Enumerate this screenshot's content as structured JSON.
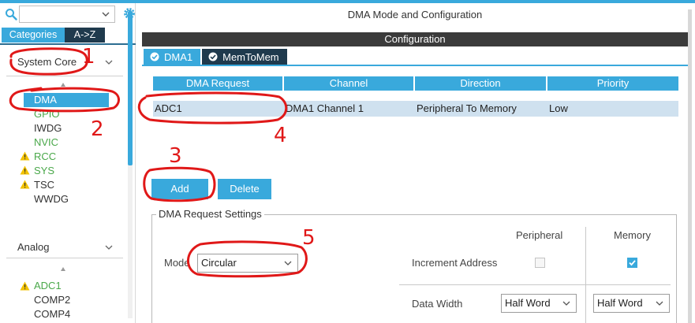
{
  "left": {
    "search": {
      "value": "",
      "placeholder": ""
    },
    "tabs": {
      "categories": "Categories",
      "az": "A->Z"
    },
    "system_core": {
      "label": "System Core",
      "items": [
        {
          "label": "DMA",
          "selected": true,
          "warning": false
        },
        {
          "label": "GPIO",
          "selected": false,
          "warning": false,
          "color": "#4aa84a"
        },
        {
          "label": "IWDG",
          "selected": false,
          "warning": false
        },
        {
          "label": "NVIC",
          "selected": false,
          "warning": false,
          "color": "#4aa84a"
        },
        {
          "label": "RCC",
          "selected": false,
          "warning": true,
          "color": "#4aa84a"
        },
        {
          "label": "SYS",
          "selected": false,
          "warning": true,
          "color": "#4aa84a"
        },
        {
          "label": "TSC",
          "selected": false,
          "warning": true
        },
        {
          "label": "WWDG",
          "selected": false,
          "warning": false
        }
      ]
    },
    "analog": {
      "label": "Analog",
      "items": [
        {
          "label": "ADC1",
          "warning": true,
          "color": "#4aa84a"
        },
        {
          "label": "COMP2",
          "warning": false
        },
        {
          "label": "COMP4",
          "warning": false
        }
      ]
    }
  },
  "right": {
    "title": "DMA Mode and Configuration",
    "config_bar": "Configuration",
    "tabs": [
      {
        "label": "DMA1",
        "active": true
      },
      {
        "label": "MemToMem",
        "active": false
      }
    ],
    "table": {
      "headers": [
        "DMA Request",
        "Channel",
        "Direction",
        "Priority"
      ],
      "rows": [
        [
          "ADC1",
          "DMA1 Channel 1",
          "Peripheral To Memory",
          "Low"
        ]
      ]
    },
    "buttons": {
      "add": "Add",
      "delete": "Delete"
    },
    "settings": {
      "legend": "DMA Request Settings",
      "col_peripheral": "Peripheral",
      "col_memory": "Memory",
      "mode_label": "Mode",
      "mode_value": "Circular",
      "increment_label": "Increment Address",
      "increment_peripheral": false,
      "increment_memory": true,
      "data_width_label": "Data Width",
      "data_width_peripheral": "Half Word",
      "data_width_memory": "Half Word"
    }
  },
  "annotations": {
    "color": "#e01818",
    "numbers": [
      "1",
      "2",
      "3",
      "4",
      "5"
    ]
  },
  "colors": {
    "accent": "#39a9dc",
    "dark_tab": "#1f3a4d",
    "config_bar": "#3b3b3b",
    "warning": "#f2c200",
    "ok_green": "#4aa84a"
  }
}
